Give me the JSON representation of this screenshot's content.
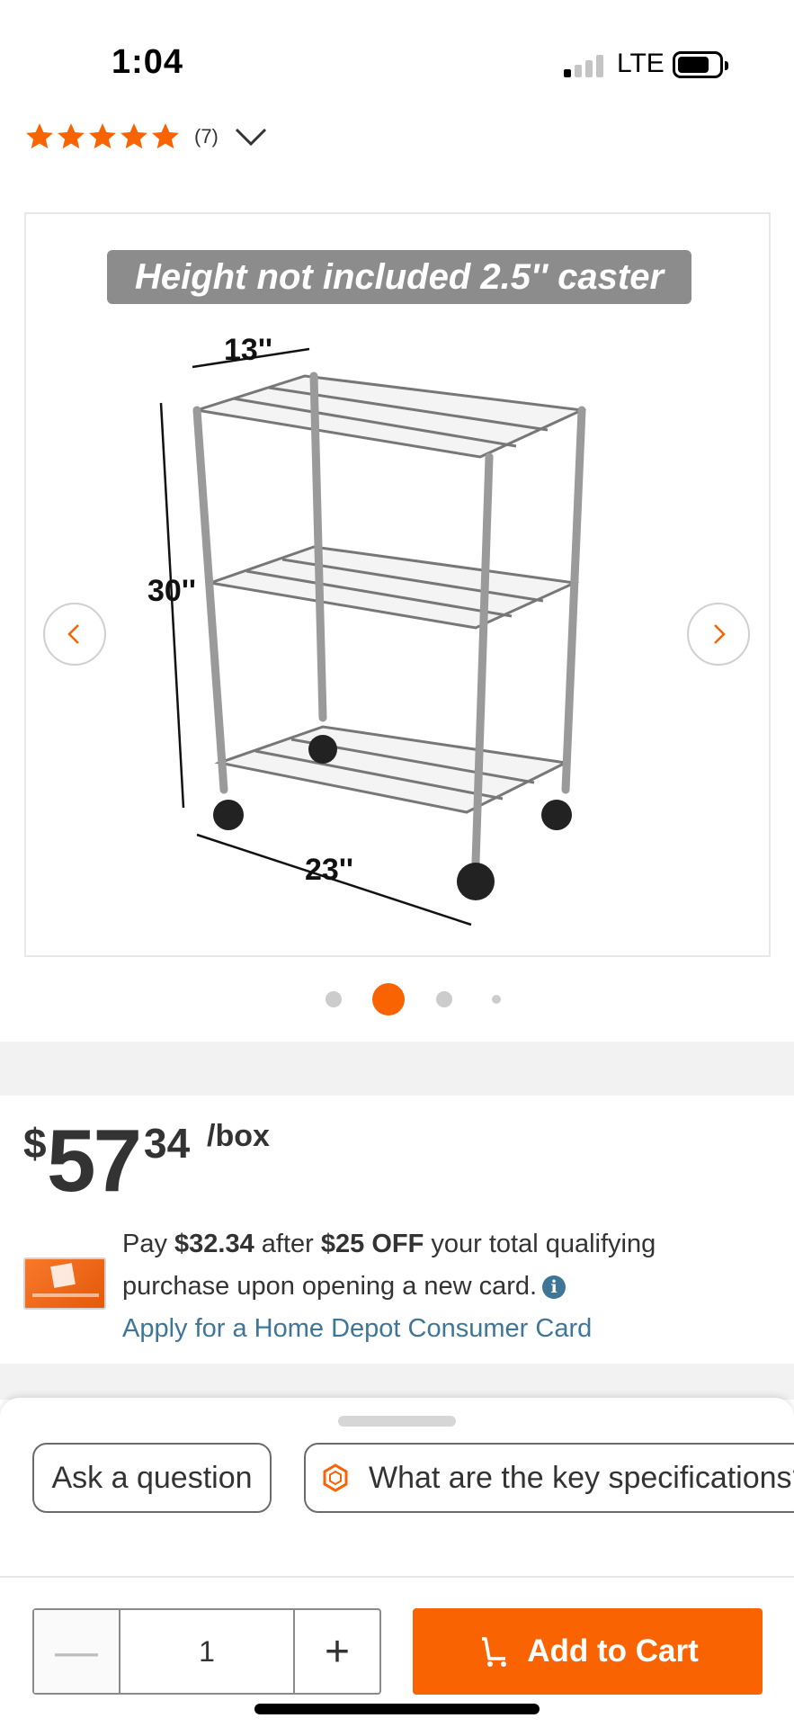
{
  "status_bar": {
    "time": "1:04",
    "network": "LTE"
  },
  "rating": {
    "stars": 5,
    "count": "(7)"
  },
  "gallery": {
    "caption": "Height not included 2.5'' caster",
    "dimensions": {
      "width": "13''",
      "height": "30''",
      "length": "23''"
    },
    "slides": 4,
    "active_slide": 2
  },
  "price": {
    "dollar_sign": "$",
    "whole": "57",
    "cents": "34",
    "unit": "/box"
  },
  "offer": {
    "pay_prefix": "Pay ",
    "pay_amount": "$32.34",
    "after_text": " after ",
    "discount": "$25 OFF",
    "rest_text": " your total qualifying purchase upon opening a new card.",
    "info_glyph": "i",
    "apply_link": "Apply for a Home Depot Consumer Card"
  },
  "chips": {
    "ask": "Ask a question",
    "spec": "What are the key specifications?"
  },
  "cart": {
    "minus": "—",
    "quantity": "1",
    "plus": "+",
    "add_label": "Add to Cart"
  },
  "colors": {
    "brand_orange": "#f96302",
    "link_blue": "#3e7697",
    "text": "#333333"
  }
}
